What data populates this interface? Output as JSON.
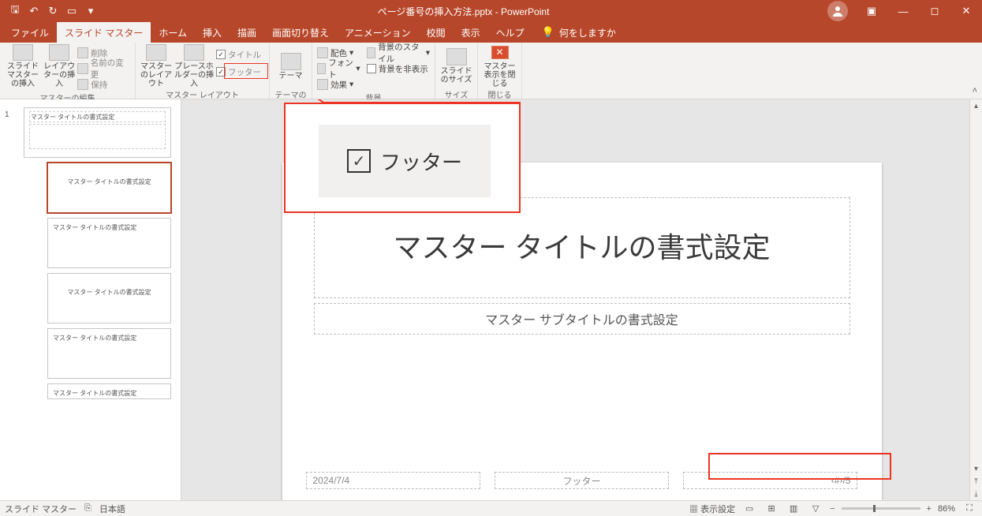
{
  "titlebar": {
    "doc_title": "ページ番号の挿入方法.pptx  -  PowerPoint"
  },
  "tabs": {
    "file": "ファイル",
    "slide_master": "スライド マスター",
    "home": "ホーム",
    "insert": "挿入",
    "draw": "描画",
    "transitions": "画面切り替え",
    "animations": "アニメーション",
    "review": "校閲",
    "view": "表示",
    "help": "ヘルプ",
    "tellme": "何をしますか"
  },
  "ribbon": {
    "g1": {
      "name": "マスターの編集",
      "insert_slide_master": "スライド マスターの挿入",
      "insert_layout": "レイアウターの挿入",
      "delete": "削除",
      "rename": "名前の変更",
      "preserve": "保持"
    },
    "g2": {
      "name": "マスター レイアウト",
      "master_layout": "マスターのレイアウト",
      "placeholder": "プレースホルダーの挿入",
      "title_ck": "タイトル",
      "footer_ck": "フッター"
    },
    "g3": {
      "name": "テーマの編集",
      "themes": "テーマ"
    },
    "g4": {
      "name": "背景",
      "colors": "配色",
      "fonts": "フォント",
      "effects": "効果",
      "bg_styles": "背景のスタイル",
      "hide_bg": "背景を非表示"
    },
    "g5": {
      "name": "サイズ",
      "slide_size": "スライドのサイズ"
    },
    "g6": {
      "name": "閉じる",
      "close_master": "マスター表示を閉じる"
    }
  },
  "callout": {
    "label": "フッター"
  },
  "slide": {
    "title": "マスター タイトルの書式設定",
    "subtitle": "マスター サブタイトルの書式設定",
    "date": "2024/7/4",
    "footer": "フッター",
    "pagenum": "‹#›/5"
  },
  "thumbs": {
    "master_title": "マスター タイトルの書式設定",
    "layout_title1": "マスター タイトルの書式設定",
    "layout_title2": "マスター タイトルの書式設定",
    "layout_title3": "マスター タイトルの書式設定",
    "layout_title4": "マスター タイトルの書式設定",
    "layout_title5": "マスター タイトルの書式設定"
  },
  "status": {
    "left1": "スライド マスター",
    "lang": "日本語",
    "display_settings": "表示設定",
    "zoom": "86%"
  }
}
